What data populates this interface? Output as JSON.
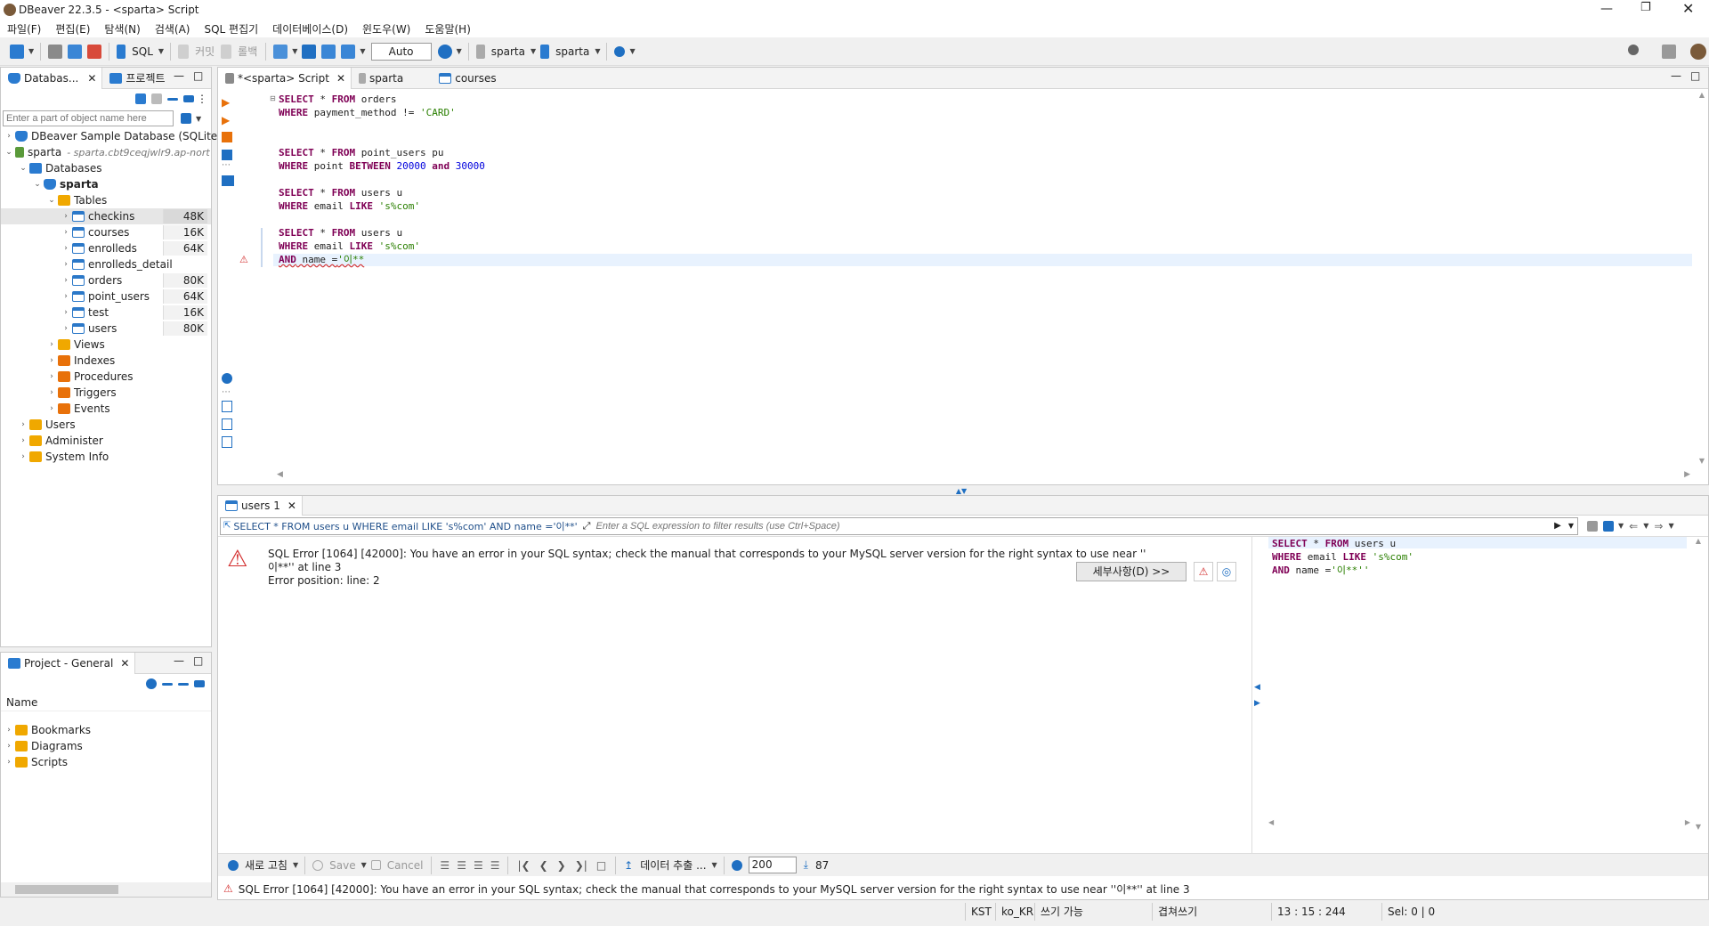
{
  "window": {
    "title": "DBeaver 22.3.5 - <sparta> Script"
  },
  "menu": [
    "파일(F)",
    "편집(E)",
    "탐색(N)",
    "검색(A)",
    "SQL 편집기",
    "데이터베이스(D)",
    "윈도우(W)",
    "도움말(H)"
  ],
  "toolbar": {
    "sql_label": "SQL",
    "commit_label": "커밋",
    "rollback_label": "롤백",
    "tx_mode": "Auto",
    "datasource": "sparta",
    "schema": "sparta"
  },
  "left_panel": {
    "tab_databases": "Databas...",
    "tab_projects": "프로젝트",
    "filter_placeholder": "Enter a part of object name here",
    "tree": {
      "sample_db": "DBeaver Sample Database (SQLite)",
      "sparta": "sparta",
      "sparta_host": "- sparta.cbt9ceqjwlr9.ap-nort",
      "databases": "Databases",
      "schema": "sparta",
      "tables": "Tables",
      "table_items": [
        {
          "name": "checkins",
          "size": "48K"
        },
        {
          "name": "courses",
          "size": "16K"
        },
        {
          "name": "enrolleds",
          "size": "64K"
        },
        {
          "name": "enrolleds_detail",
          "size": ""
        },
        {
          "name": "orders",
          "size": "80K"
        },
        {
          "name": "point_users",
          "size": "64K"
        },
        {
          "name": "test",
          "size": "16K"
        },
        {
          "name": "users",
          "size": "80K"
        }
      ],
      "views": "Views",
      "indexes": "Indexes",
      "procedures": "Procedures",
      "triggers": "Triggers",
      "events": "Events",
      "users": "Users",
      "administer": "Administer",
      "system_info": "System Info"
    }
  },
  "project_panel": {
    "title": "Project - General",
    "col_name": "Name",
    "items": [
      "Bookmarks",
      "Diagrams",
      "Scripts"
    ]
  },
  "editor": {
    "tabs": [
      "*<sparta> Script",
      "sparta",
      "courses"
    ],
    "lines": [
      {
        "kw1": "SELECT",
        "t1": " * ",
        "kw2": "FROM",
        "t2": " orders"
      },
      {
        "kw1": "WHERE",
        "t1": " payment_method != ",
        "str": "'CARD'"
      },
      {
        "kw1": "SELECT",
        "t1": " * ",
        "kw2": "FROM",
        "t2": " point_users pu"
      },
      {
        "kw1": "WHERE",
        "t1": " point ",
        "kw2": "BETWEEN",
        "n1": " 20000 ",
        "kw3": "and",
        "n2": " 30000"
      },
      {
        "kw1": "SELECT",
        "t1": " * ",
        "kw2": "FROM",
        "t2": " users u"
      },
      {
        "kw1": "WHERE",
        "t1": " email ",
        "kw2": "LIKE",
        "str": " 's%com'"
      },
      {
        "kw1": "SELECT",
        "t1": " * ",
        "kw2": "FROM",
        "t2": " users u"
      },
      {
        "kw1": "WHERE",
        "t1": " email ",
        "kw2": "LIKE",
        "str": " 's%com'"
      },
      {
        "kw1": "AND",
        "t1": " name =",
        "str": "'이**"
      }
    ]
  },
  "results": {
    "tab": "users 1",
    "query_text": "SELECT * FROM users u WHERE email LIKE 's%com' AND name ='이**'",
    "filter_placeholder": "Enter a SQL expression to filter results (use Ctrl+Space)",
    "error_line1": "SQL Error [1064] [42000]: You have an error in your SQL syntax; check the manual that corresponds to your MySQL server version for the right syntax to use near ''",
    "error_line2": "이**'' at line 3",
    "error_line3": "Error position: line: 2",
    "details_button": "세부사항(D) >>",
    "side_sql": [
      {
        "kw1": "SELECT",
        "t1": " * ",
        "kw2": "FROM",
        "t2": " users u"
      },
      {
        "kw1": "WHERE",
        "t1": " email ",
        "kw2": "LIKE",
        "str": " 's%com'"
      },
      {
        "kw1": "AND",
        "t1": " name =",
        "str": "'이**''"
      }
    ],
    "bottom_toolbar": {
      "refresh": "새로 고침",
      "save": "Save",
      "cancel": "Cancel",
      "export": "데이터 추출 ...",
      "fetch_size": "200",
      "row_count": "87"
    }
  },
  "status": {
    "error_message": "SQL Error [1064] [42000]: You have an error in your SQL syntax; check the manual that corresponds to your MySQL server version for the right syntax to use near ''이**'' at line 3",
    "timezone": "KST",
    "locale": "ko_KR",
    "mode": "쓰기 가능",
    "insert_mode": "겹쳐쓰기",
    "position": "13 : 15 : 244",
    "selection": "Sel: 0 | 0"
  },
  "colors": {
    "keyword": "#7f0055",
    "string": "#2a7f00",
    "number": "#0000dd",
    "error": "#d32f2f",
    "accent": "#1f6fc2"
  }
}
